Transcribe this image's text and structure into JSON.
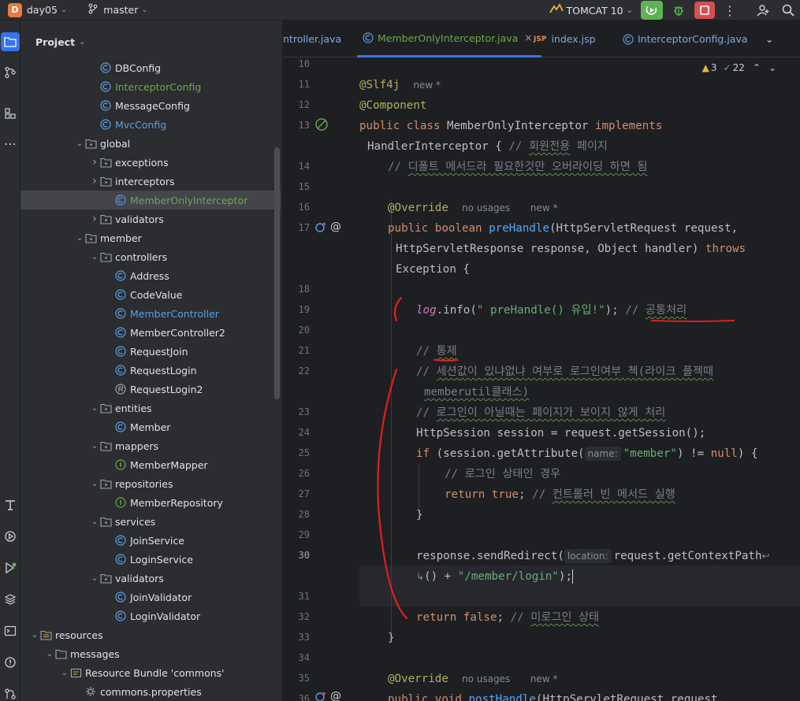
{
  "topbar": {
    "project_badge": "D",
    "project_name": "day05",
    "branch_name": "master",
    "run_config": "TOMCAT 10"
  },
  "project_panel": {
    "title": "Project",
    "items": [
      {
        "label": "DBConfig",
        "type": "class",
        "depth": 7,
        "color": "normal"
      },
      {
        "label": "InterceptorConfig",
        "type": "class",
        "depth": 7,
        "color": "green"
      },
      {
        "label": "MessageConfig",
        "type": "class",
        "depth": 7,
        "color": "normal"
      },
      {
        "label": "MvcConfig",
        "type": "class",
        "depth": 7,
        "color": "blue"
      },
      {
        "label": "global",
        "type": "folder",
        "depth": 6,
        "expanded": true
      },
      {
        "label": "exceptions",
        "type": "folder",
        "depth": 7,
        "expanded": false
      },
      {
        "label": "interceptors",
        "type": "folder",
        "depth": 7,
        "expanded": false
      },
      {
        "label": "MemberOnlyInterceptor",
        "type": "class",
        "depth": 8,
        "color": "green",
        "selected": true
      },
      {
        "label": "validators",
        "type": "folder",
        "depth": 7,
        "expanded": false
      },
      {
        "label": "member",
        "type": "folder",
        "depth": 6,
        "expanded": true
      },
      {
        "label": "controllers",
        "type": "folder",
        "depth": 7,
        "expanded": true
      },
      {
        "label": "Address",
        "type": "class",
        "depth": 8,
        "color": "normal"
      },
      {
        "label": "CodeValue",
        "type": "class",
        "depth": 8,
        "color": "normal"
      },
      {
        "label": "MemberController",
        "type": "class",
        "depth": 8,
        "color": "blue"
      },
      {
        "label": "MemberController2",
        "type": "class",
        "depth": 8,
        "color": "normal"
      },
      {
        "label": "RequestJoin",
        "type": "class",
        "depth": 8,
        "color": "normal"
      },
      {
        "label": "RequestLogin",
        "type": "class",
        "depth": 8,
        "color": "normal"
      },
      {
        "label": "RequestLogin2",
        "type": "record",
        "depth": 8,
        "color": "normal"
      },
      {
        "label": "entities",
        "type": "folder",
        "depth": 7,
        "expanded": true
      },
      {
        "label": "Member",
        "type": "class",
        "depth": 8,
        "color": "normal"
      },
      {
        "label": "mappers",
        "type": "folder",
        "depth": 7,
        "expanded": true
      },
      {
        "label": "MemberMapper",
        "type": "interface",
        "depth": 8,
        "color": "normal"
      },
      {
        "label": "repositories",
        "type": "folder",
        "depth": 7,
        "expanded": true
      },
      {
        "label": "MemberRepository",
        "type": "interface",
        "depth": 8,
        "color": "normal"
      },
      {
        "label": "services",
        "type": "folder",
        "depth": 7,
        "expanded": true
      },
      {
        "label": "JoinService",
        "type": "class",
        "depth": 8,
        "color": "normal"
      },
      {
        "label": "LoginService",
        "type": "class",
        "depth": 8,
        "color": "normal"
      },
      {
        "label": "validators",
        "type": "folder",
        "depth": 7,
        "expanded": true
      },
      {
        "label": "JoinValidator",
        "type": "class",
        "depth": 8,
        "color": "normal"
      },
      {
        "label": "LoginValidator",
        "type": "class",
        "depth": 8,
        "color": "normal"
      },
      {
        "label": "resources",
        "type": "resfolder",
        "depth": 3,
        "expanded": true
      },
      {
        "label": "messages",
        "type": "plainfolder",
        "depth": 4,
        "expanded": true
      },
      {
        "label": "Resource Bundle 'commons'",
        "type": "bundle",
        "depth": 5,
        "expanded": true
      },
      {
        "label": "commons.properties",
        "type": "props",
        "depth": 6
      }
    ]
  },
  "tabs": [
    {
      "label": "ntroller.java",
      "icon": "class",
      "active": false
    },
    {
      "label": "MemberOnlyInterceptor.java",
      "icon": "class",
      "active": true,
      "close": "×"
    },
    {
      "label": "index.jsp",
      "icon": "jsp",
      "active": false
    },
    {
      "label": "InterceptorConfig.java",
      "icon": "class",
      "active": false
    }
  ],
  "inspections": {
    "warnings": "3",
    "checks": "22"
  },
  "editor": {
    "lines": [
      {
        "num": "10"
      },
      {
        "num": "11",
        "y": 26
      },
      {
        "num": "12"
      },
      {
        "num": "13"
      },
      {
        "num": "14"
      },
      {
        "num": "15"
      },
      {
        "num": "16"
      },
      {
        "num": "17"
      },
      {
        "num": "18"
      },
      {
        "num": "19"
      },
      {
        "num": "20"
      },
      {
        "num": "21"
      },
      {
        "num": "22"
      },
      {
        "num": "23"
      },
      {
        "num": "24"
      },
      {
        "num": "25"
      },
      {
        "num": "26"
      },
      {
        "num": "27"
      },
      {
        "num": "28"
      },
      {
        "num": "29"
      },
      {
        "num": "30"
      },
      {
        "num": "31"
      },
      {
        "num": "32"
      },
      {
        "num": "33"
      },
      {
        "num": "34"
      },
      {
        "num": "35"
      },
      {
        "num": "36"
      }
    ],
    "code": {
      "l11_ann": "@Slf4j",
      "l11_hint": "new *",
      "l12_ann": "@Component",
      "l13_a": "public class ",
      "l13_b": "MemberOnlyInterceptor ",
      "l13_c": "implements",
      "l13b_a": "HandlerInterceptor { ",
      "l13b_b": "// ",
      "l13b_c": "회원전용",
      "l13b_d": " 페이지",
      "l14_a": "// ",
      "l14_b": "디폴트 메서드라 필요한것만 오버라이딩 하면 됨",
      "l16_ann": "@Override",
      "l16_h1": "no usages",
      "l16_h2": "new *",
      "l17_a": "public boolean ",
      "l17_b": "preHandle",
      "l17_c": "(HttpServletRequest request,",
      "l17b_a": "HttpServletResponse response, Object handler) ",
      "l17b_b": "throws",
      "l17c": "Exception {",
      "l19_a": "log",
      "l19_b": ".info(",
      "l19_c": "\" preHandle() 유입!\"",
      "l19_d": "); ",
      "l19_e": "// ",
      "l19_f": "공통처리",
      "l21_a": "// ",
      "l21_b": "통제",
      "l22_a": "// ",
      "l22_b": "세션값이 있냐없냐 여부로 로그인여부 첵(라이크 플젝때",
      "l22b": "memberutil클래스)",
      "l23_a": "// ",
      "l23_b": "로그인이 아닐때는 페이지가 보이지 않게 처리",
      "l24": "HttpSession session = request.getSession();",
      "l25_a": "if ",
      "l25_b": "(session.getAttribute(",
      "l25_hint": "name:",
      "l25_c": "\"member\"",
      "l25_d": ") != ",
      "l25_e": "null",
      "l25_f": ") {",
      "l26": "// 로그인 상태인 경우",
      "l27_a": "return true",
      "l27_b": "; ",
      "l27_c": "// ",
      "l27_d": "컨트롤러 빈 메서드 실행",
      "l28": "}",
      "l30_a": "response.sendRedirect(",
      "l30_hint": "location:",
      "l30_b": "request.getContextPath",
      "l30b_a": "() + ",
      "l30b_b": "\"/member/login\"",
      "l30b_c": ");",
      "l32_a": "return false",
      "l32_b": "; ",
      "l32_c": "// ",
      "l32_d": "미로그인 상태",
      "l33": "}",
      "l35_ann": "@Override",
      "l35_h1": "no usages",
      "l35_h2": "new *",
      "l36_a": "public void ",
      "l36_b": "postHandle",
      "l36_c": "(HttpServletRequest request,"
    }
  },
  "colors": {
    "annotation_red": "#e02020",
    "accent": "#3574f0"
  }
}
